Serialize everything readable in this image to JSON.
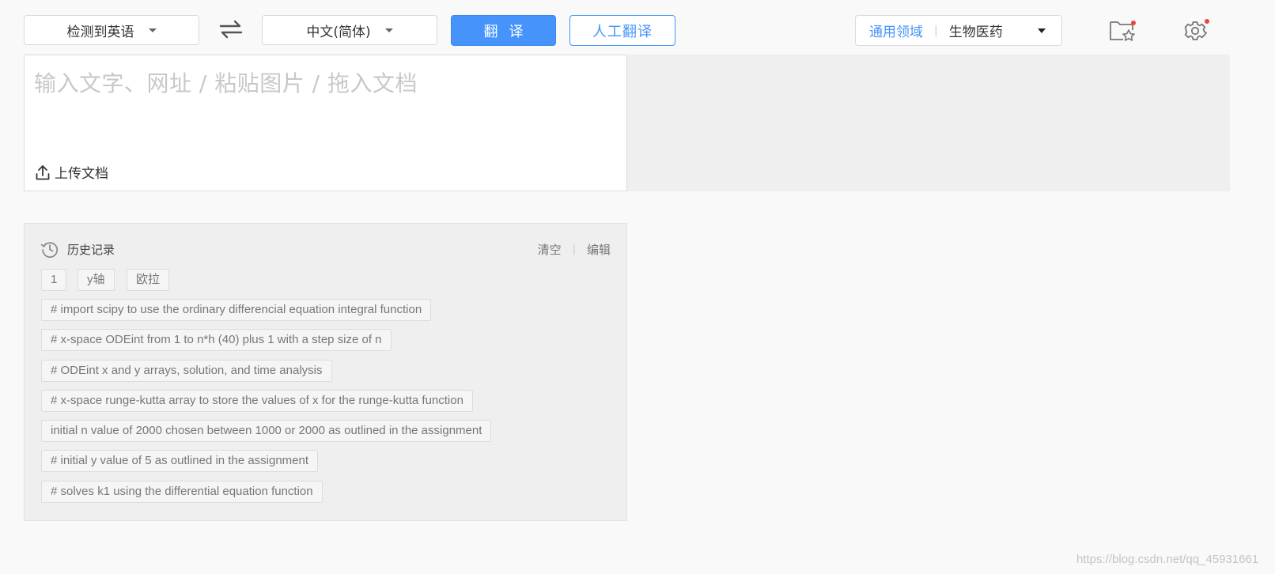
{
  "toolbar": {
    "source_lang": "检测到英语",
    "target_lang": "中文(简体)",
    "translate_label": "翻译",
    "human_translate_label": "人工翻译",
    "domain_general": "通用领域",
    "domain_separator": "|",
    "domain_current": "生物医药"
  },
  "input": {
    "placeholder": "输入文字、网址 / 粘贴图片 / 拖入文档",
    "upload_label": "上传文档"
  },
  "history": {
    "title": "历史记录",
    "clear_label": "清空",
    "separator": "|",
    "edit_label": "编辑",
    "items": [
      "1",
      "y轴",
      "欧拉",
      "# import scipy to use the ordinary differencial equation integral function",
      "# x-space ODEint from 1 to n*h (40) plus 1 with a step size of n",
      "# ODEint x and y arrays, solution, and time analysis",
      "# x-space runge-kutta array to store the values of x for the runge-kutta function",
      "initial n value of 2000 chosen between 1000 or 2000 as outlined in the assignment",
      "# initial y value of 5 as outlined in the assignment",
      "# solves k1 using the differential equation function"
    ]
  },
  "watermark": "https://blog.csdn.net/qq_45931661",
  "colors": {
    "accent": "#4593fb",
    "notification_dot": "#f0443a"
  }
}
